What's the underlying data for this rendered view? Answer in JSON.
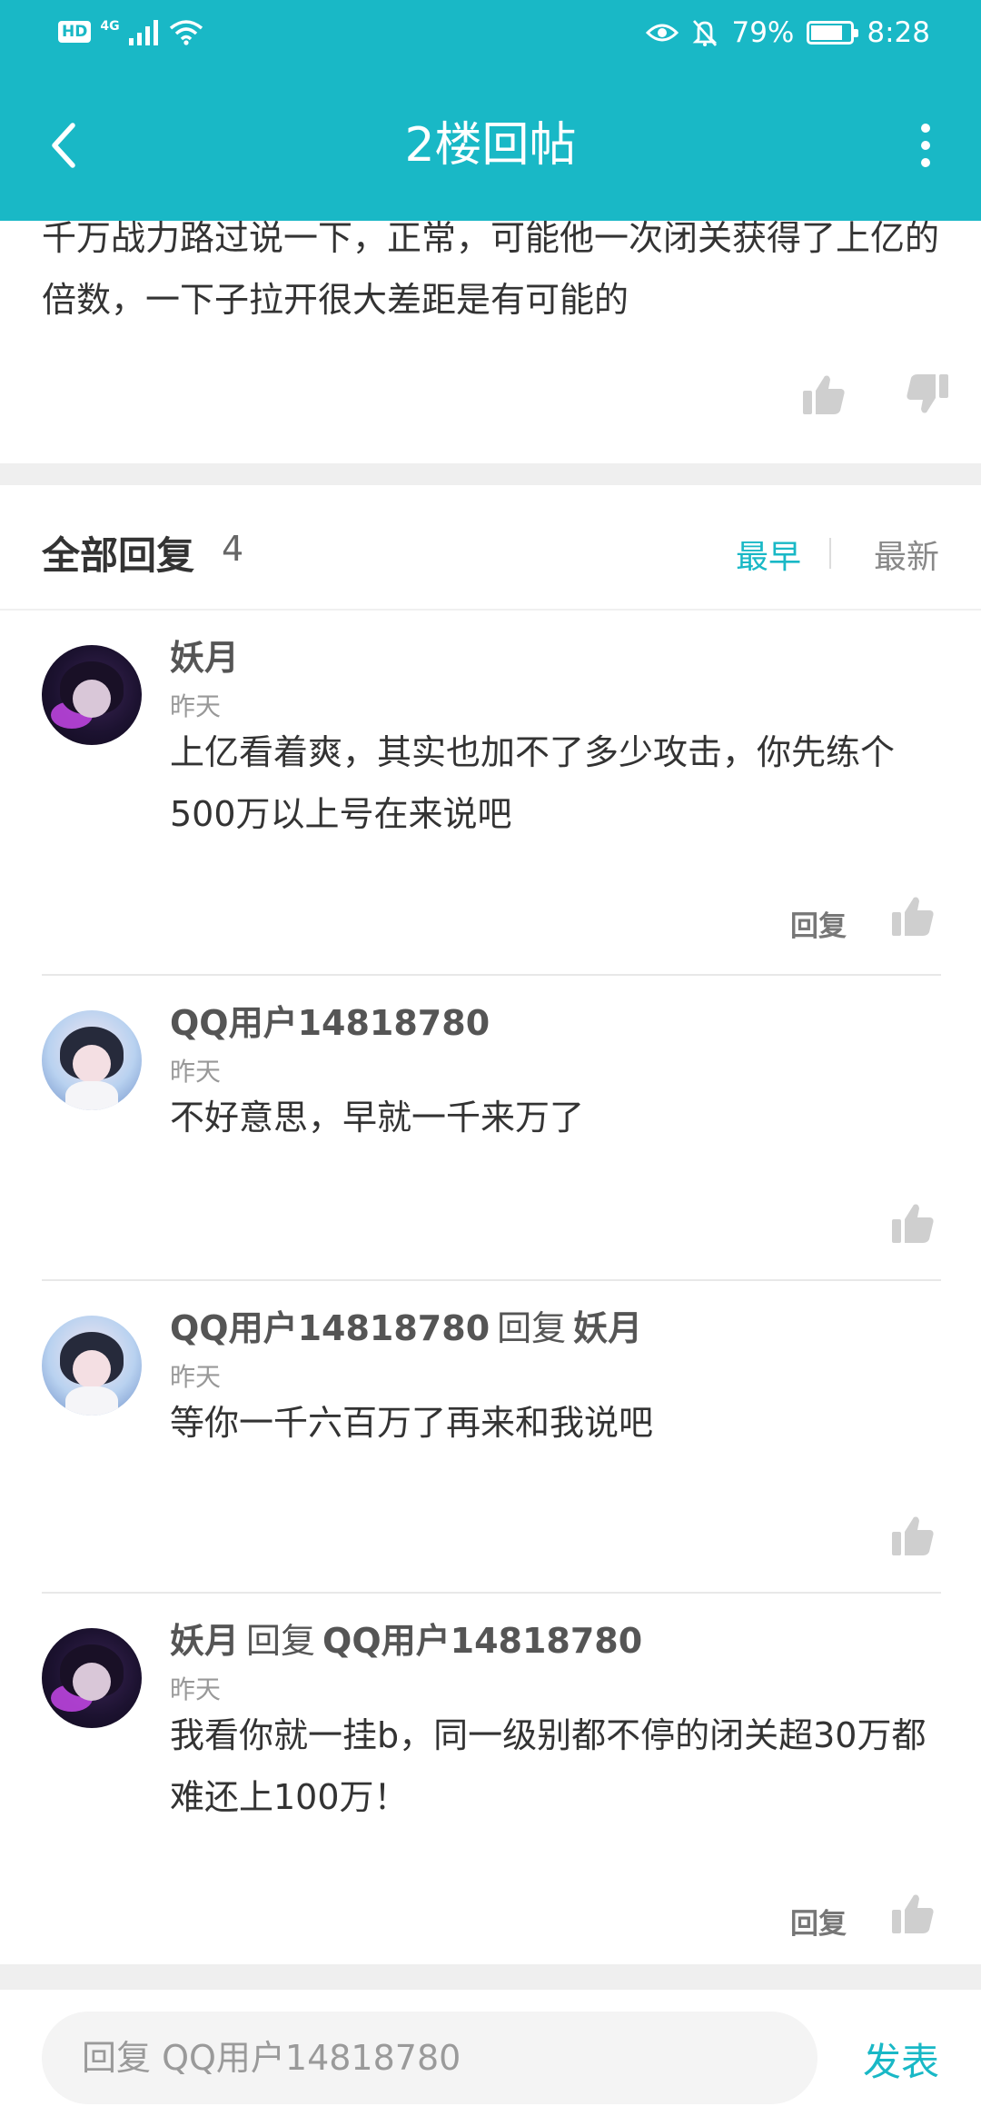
{
  "status_bar": {
    "hd": "HD",
    "network": "4G",
    "battery_text": "79%",
    "battery_level": 0.79,
    "time": "8:28",
    "icons": [
      "signal-icon",
      "wifi-icon",
      "eye-icon",
      "bell-muted-icon",
      "battery-icon"
    ]
  },
  "header": {
    "title": "2楼回帖",
    "back_icon": "back-arrow-icon",
    "more_icon": "more-vertical-icon",
    "color": "#19b8c6"
  },
  "post": {
    "text": "千万战力路过说一下，正常，可能他一次闭关获得了上亿的倍数，一下子拉开很大差距是有可能的",
    "actions": [
      "like-icon",
      "dislike-icon"
    ]
  },
  "replies_header": {
    "title": "全部回复",
    "count": "4",
    "sort_earliest": "最早",
    "sort_latest": "最新",
    "active_sort": "最早"
  },
  "replies": [
    {
      "avatar": "avatar-yaoyue",
      "user": "妖月",
      "reply_word": "",
      "reply_to": "",
      "time": "昨天",
      "text": "上亿看着爽，其实也加不了多少攻击，你先练个500万以上号在来说吧",
      "reply_label": "回复"
    },
    {
      "avatar": "avatar-qquser",
      "user": "QQ用户14818780",
      "reply_word": "",
      "reply_to": "",
      "time": "昨天",
      "text": "不好意思，早就一千来万了",
      "reply_label": ""
    },
    {
      "avatar": "avatar-qquser",
      "user": "QQ用户14818780",
      "reply_word": "回复",
      "reply_to": "妖月",
      "time": "昨天",
      "text": "等你一千六百万了再来和我说吧",
      "reply_label": ""
    },
    {
      "avatar": "avatar-yaoyue",
      "user": "妖月",
      "reply_word": "回复",
      "reply_to": "QQ用户14818780",
      "time": "昨天",
      "text": "我看你就一挂b，同一级别都不停的闭关超30万都难还上100万！",
      "reply_label": "回复"
    }
  ],
  "input": {
    "placeholder": "回复 QQ用户14818780",
    "value": ""
  },
  "publish_label": "发表"
}
